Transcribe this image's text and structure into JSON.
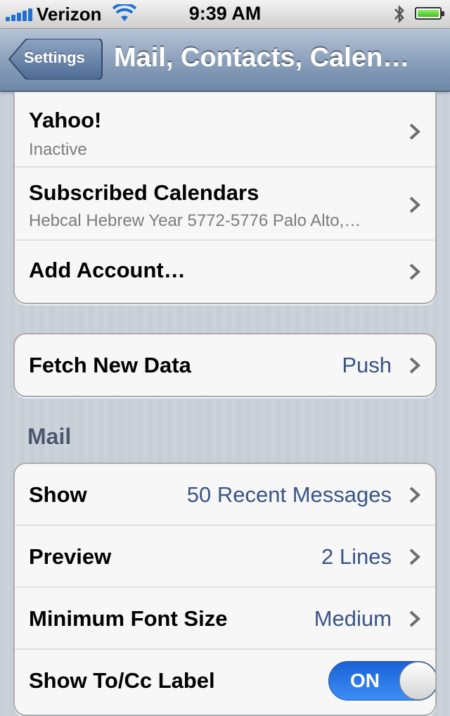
{
  "status_bar": {
    "carrier": "Verizon",
    "time": "9:39 AM"
  },
  "nav": {
    "back_label": "Settings",
    "title": "Mail, Contacts, Calen…"
  },
  "accounts": {
    "rows": [
      {
        "title": "Yahoo!",
        "subtitle": "Inactive"
      },
      {
        "title": "Subscribed Calendars",
        "subtitle": "Hebcal Hebrew Year 5772-5776 Palo Alto,…"
      },
      {
        "title": "Add Account…"
      }
    ]
  },
  "fetch": {
    "title": "Fetch New Data",
    "value": "Push"
  },
  "mail": {
    "header": "Mail",
    "rows": [
      {
        "title": "Show",
        "value": "50 Recent Messages"
      },
      {
        "title": "Preview",
        "value": "2 Lines"
      },
      {
        "title": "Minimum Font Size",
        "value": "Medium"
      },
      {
        "title": "Show To/Cc Label",
        "toggle": "ON"
      }
    ]
  },
  "colors": {
    "value_text": "#385487",
    "toggle_on": "#1a61d6"
  }
}
